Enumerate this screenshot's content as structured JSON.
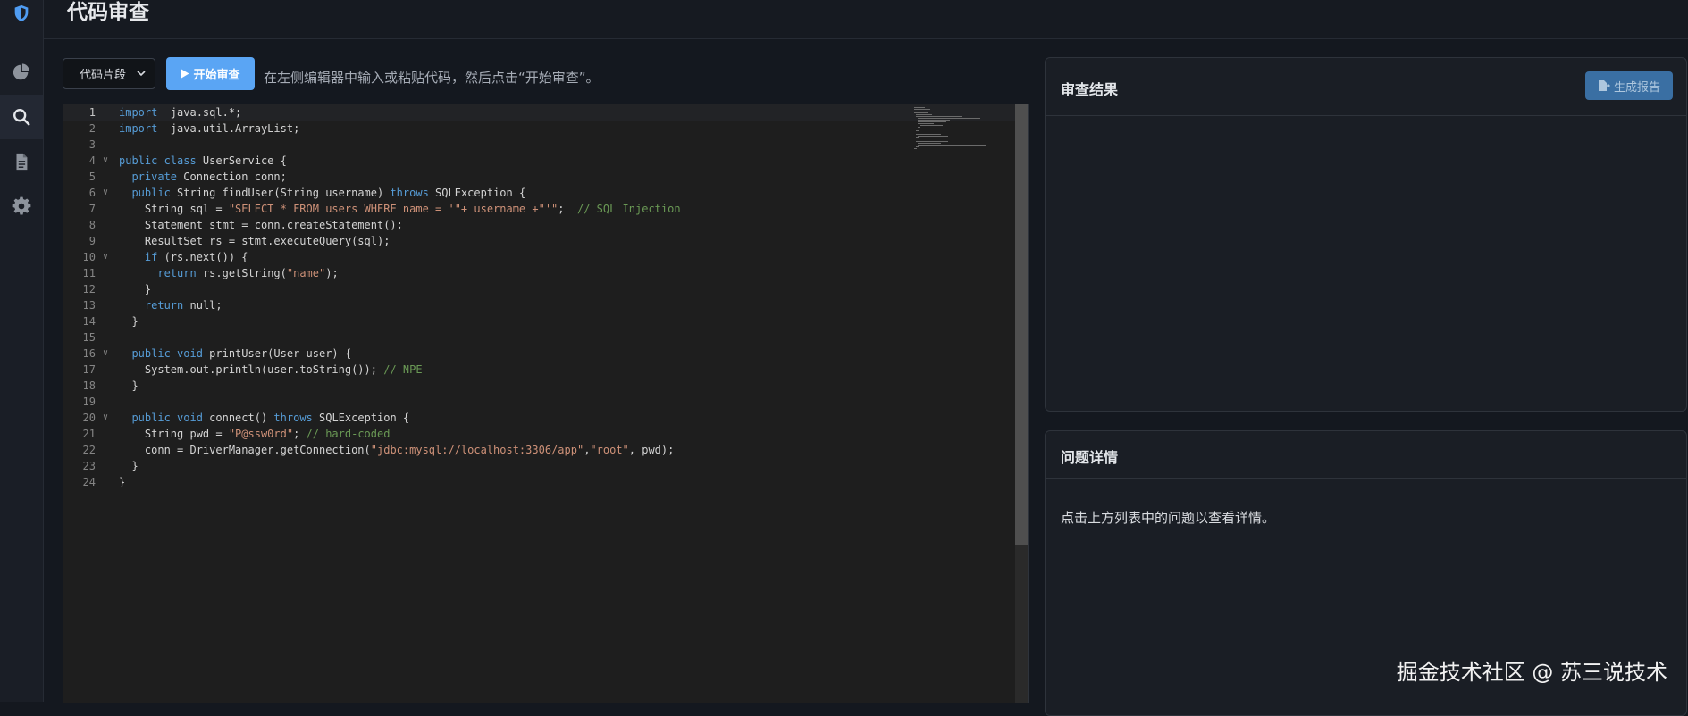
{
  "sidebar": {
    "items": [
      {
        "icon": "shield-icon"
      },
      {
        "icon": "pie-chart-icon"
      },
      {
        "icon": "search-icon",
        "active": true
      },
      {
        "icon": "document-icon"
      },
      {
        "icon": "gear-icon"
      }
    ]
  },
  "header": {
    "title": "代码审查"
  },
  "toolbar": {
    "select_value": "代码片段",
    "start_label": "开始审查",
    "hint": "在左侧编辑器中输入或粘贴代码，然后点击“开始审查”。"
  },
  "editor": {
    "lines": [
      {
        "n": "1",
        "fold": false,
        "segments": [
          [
            "kw",
            "import"
          ],
          [
            "",
            "  java.sql.*;"
          ]
        ]
      },
      {
        "n": "2",
        "fold": false,
        "segments": [
          [
            "kw",
            "import"
          ],
          [
            "",
            "  java.util.ArrayList;"
          ]
        ]
      },
      {
        "n": "3",
        "fold": false,
        "segments": []
      },
      {
        "n": "4",
        "fold": true,
        "segments": [
          [
            "kw",
            "public class"
          ],
          [
            "",
            " UserService {"
          ]
        ]
      },
      {
        "n": "5",
        "fold": false,
        "segments": [
          [
            "",
            "  "
          ],
          [
            "kw",
            "private"
          ],
          [
            "",
            " Connection conn;"
          ]
        ]
      },
      {
        "n": "6",
        "fold": true,
        "segments": [
          [
            "",
            "  "
          ],
          [
            "kw",
            "public"
          ],
          [
            "",
            " String findUser(String username) "
          ],
          [
            "kw",
            "throws"
          ],
          [
            "",
            " SQLException {"
          ]
        ]
      },
      {
        "n": "7",
        "fold": false,
        "segments": [
          [
            "",
            "    String sql = "
          ],
          [
            "str",
            "\"SELECT * FROM users WHERE name = '\"+ username +\"'\""
          ],
          [
            "",
            ";  "
          ],
          [
            "cm",
            "// SQL Injection"
          ]
        ]
      },
      {
        "n": "8",
        "fold": false,
        "segments": [
          [
            "",
            "    Statement stmt = conn.createStatement();"
          ]
        ]
      },
      {
        "n": "9",
        "fold": false,
        "segments": [
          [
            "",
            "    ResultSet rs = stmt.executeQuery(sql);"
          ]
        ]
      },
      {
        "n": "10",
        "fold": true,
        "segments": [
          [
            "",
            "    "
          ],
          [
            "kw",
            "if"
          ],
          [
            "",
            " (rs.next()) {"
          ]
        ]
      },
      {
        "n": "11",
        "fold": false,
        "segments": [
          [
            "",
            "      "
          ],
          [
            "kw",
            "return"
          ],
          [
            "",
            " rs.getString("
          ],
          [
            "str",
            "\"name\""
          ],
          [
            "",
            ");"
          ]
        ]
      },
      {
        "n": "12",
        "fold": false,
        "segments": [
          [
            "",
            "    }"
          ]
        ]
      },
      {
        "n": "13",
        "fold": false,
        "segments": [
          [
            "",
            "    "
          ],
          [
            "kw",
            "return"
          ],
          [
            "",
            " null;"
          ]
        ]
      },
      {
        "n": "14",
        "fold": false,
        "segments": [
          [
            "",
            "  }"
          ]
        ]
      },
      {
        "n": "15",
        "fold": false,
        "segments": []
      },
      {
        "n": "16",
        "fold": true,
        "segments": [
          [
            "",
            "  "
          ],
          [
            "kw",
            "public void"
          ],
          [
            "",
            " printUser(User user) {"
          ]
        ]
      },
      {
        "n": "17",
        "fold": false,
        "segments": [
          [
            "",
            "    System.out.println(user.toString()); "
          ],
          [
            "cm",
            "// NPE"
          ]
        ]
      },
      {
        "n": "18",
        "fold": false,
        "segments": [
          [
            "",
            "  }"
          ]
        ]
      },
      {
        "n": "19",
        "fold": false,
        "segments": []
      },
      {
        "n": "20",
        "fold": true,
        "segments": [
          [
            "",
            "  "
          ],
          [
            "kw",
            "public void"
          ],
          [
            "",
            " connect() "
          ],
          [
            "kw",
            "throws"
          ],
          [
            "",
            " SQLException {"
          ]
        ]
      },
      {
        "n": "21",
        "fold": false,
        "segments": [
          [
            "",
            "    String pwd = "
          ],
          [
            "str",
            "\"P@ssw0rd\""
          ],
          [
            "",
            "; "
          ],
          [
            "cm",
            "// hard-coded"
          ]
        ]
      },
      {
        "n": "22",
        "fold": false,
        "segments": [
          [
            "",
            "    conn = DriverManager.getConnection("
          ],
          [
            "str",
            "\"jdbc:mysql://localhost:3306/app\""
          ],
          [
            "",
            ","
          ],
          [
            "str",
            "\"root\""
          ],
          [
            "",
            ", pwd);"
          ]
        ]
      },
      {
        "n": "23",
        "fold": false,
        "segments": [
          [
            "",
            "  }"
          ]
        ]
      },
      {
        "n": "24",
        "fold": false,
        "segments": [
          [
            "",
            "}"
          ]
        ]
      }
    ]
  },
  "results_panel": {
    "title": "审查结果",
    "report_button": "生成报告"
  },
  "details_panel": {
    "title": "问题详情",
    "placeholder": "点击上方列表中的问题以查看详情。"
  },
  "watermark": "掘金技术社区 @ 苏三说技术",
  "colors": {
    "accent": "#5aa5f4",
    "background": "#14181f",
    "keyword": "#569cd6",
    "string": "#ce9178",
    "comment": "#6a9955"
  }
}
